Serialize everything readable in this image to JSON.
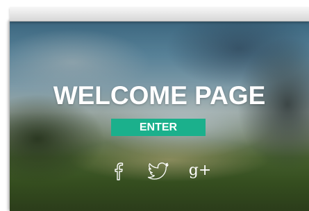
{
  "page": {
    "title": "WELCOME PAGE",
    "enter_label": "ENTER"
  },
  "social": [
    {
      "name": "facebook",
      "icon": "facebook-icon",
      "glyph": "f"
    },
    {
      "name": "twitter",
      "icon": "twitter-icon"
    },
    {
      "name": "google-plus",
      "icon": "google-plus-icon",
      "glyph": "g+"
    }
  ],
  "colors": {
    "accent": "#1bb08c",
    "text": "#ffffff"
  }
}
